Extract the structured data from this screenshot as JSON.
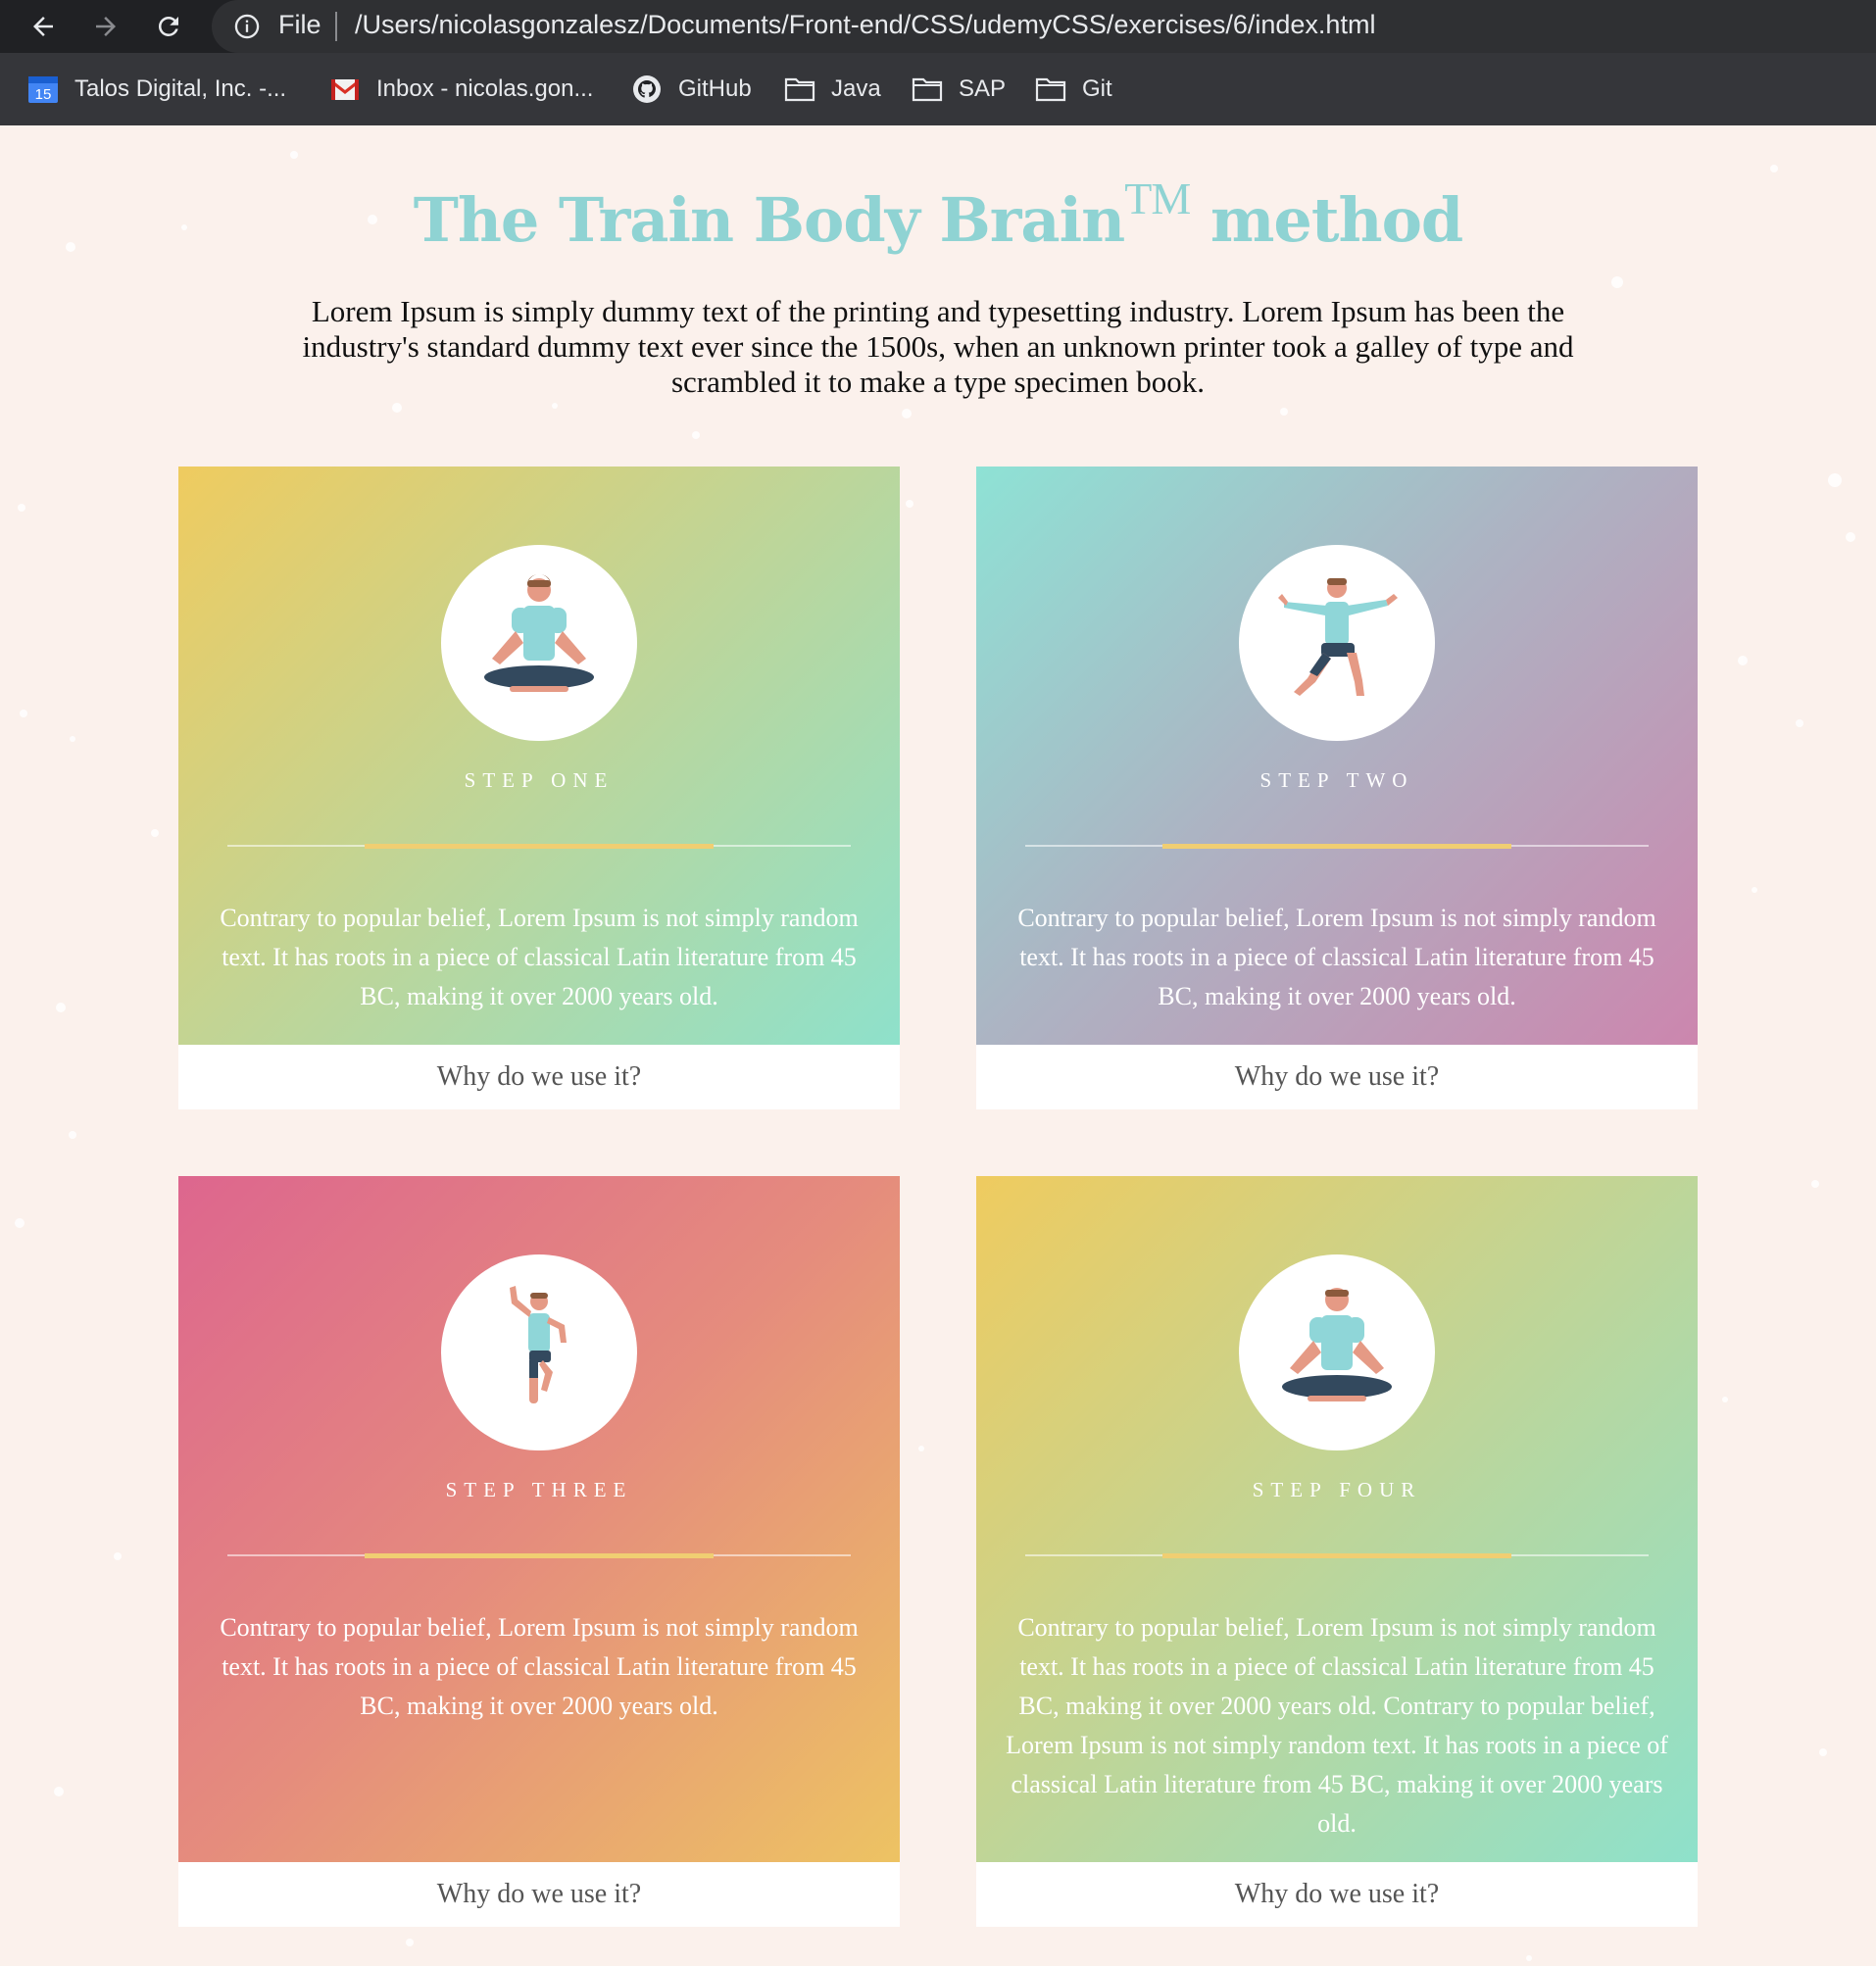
{
  "browser": {
    "url_scheme": "File",
    "url": "/Users/nicolasgonzalesz/Documents/Front-end/CSS/udemyCSS/exercises/6/index.html",
    "bookmarks": [
      {
        "label": "Talos Digital, Inc. -...",
        "icon": "calendar-icon",
        "badge": "15"
      },
      {
        "label": "Inbox - nicolas.gon...",
        "icon": "gmail-icon"
      },
      {
        "label": "GitHub",
        "icon": "github-icon"
      },
      {
        "label": "Java",
        "icon": "folder-icon"
      },
      {
        "label": "SAP",
        "icon": "folder-icon"
      },
      {
        "label": "Git",
        "icon": "folder-icon"
      }
    ]
  },
  "page": {
    "title": "The Train Body Brain",
    "title_sup": "TM",
    "title_suffix": "method",
    "intro": "Lorem Ipsum is simply dummy text of the printing and typesetting industry. Lorem Ipsum has been the industry's standard dummy text ever since the 1500s, when an unknown printer took a galley of type and scrambled it to make a type specimen book.",
    "colors": {
      "title": "#8fd3d3",
      "background": "#fbf1ec",
      "accent": "#f0ce72"
    }
  },
  "cards": [
    {
      "step": "STEP ONE",
      "icon": "meditating-person-icon",
      "text": "Contrary to popular belief, Lorem Ipsum is not simply random text. It has roots in a piece of classical Latin literature from 45 BC, making it over 2000 years old.",
      "link": "Why do we use it?"
    },
    {
      "step": "STEP TWO",
      "icon": "stretching-person-icon",
      "text": "Contrary to popular belief, Lorem Ipsum is not simply random text. It has roots in a piece of classical Latin literature from 45 BC, making it over 2000 years old.",
      "link": "Why do we use it?"
    },
    {
      "step": "STEP THREE",
      "icon": "dancing-person-icon",
      "text": "Contrary to popular belief, Lorem Ipsum is not simply random text. It has roots in a piece of classical Latin literature from 45 BC, making it over 2000 years old.",
      "link": "Why do we use it?"
    },
    {
      "step": "STEP FOUR",
      "icon": "meditating-person-icon",
      "text": "Contrary to popular belief, Lorem Ipsum is not simply random text. It has roots in a piece of classical Latin literature from 45 BC, making it over 2000 years old. Contrary to popular belief, Lorem Ipsum is not simply random text. It has roots in a piece of classical Latin literature from 45 BC, making it over 2000 years old.",
      "link": "Why do we use it?"
    }
  ]
}
